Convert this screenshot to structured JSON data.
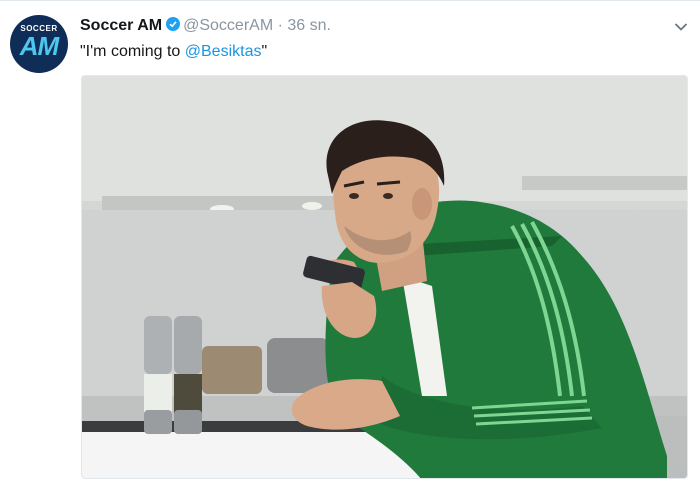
{
  "account": {
    "avatar_top_text": "SOCCER",
    "avatar_logo_text": "AM",
    "name": "Soccer AM",
    "handle": "@SoccerAM",
    "separator": "·",
    "time": "36 sn."
  },
  "tweet": {
    "text_before": "\"I'm coming to ",
    "mention": "@Besiktas",
    "text_after": "\""
  },
  "icons": {
    "verified": "verified-badge-icon",
    "menu": "chevron-down-icon"
  },
  "colors": {
    "link": "#1b95e0",
    "verified": "#1da1f2",
    "avatar_bg": "#0f2d56",
    "jacket_green": "#1f7a3c"
  }
}
